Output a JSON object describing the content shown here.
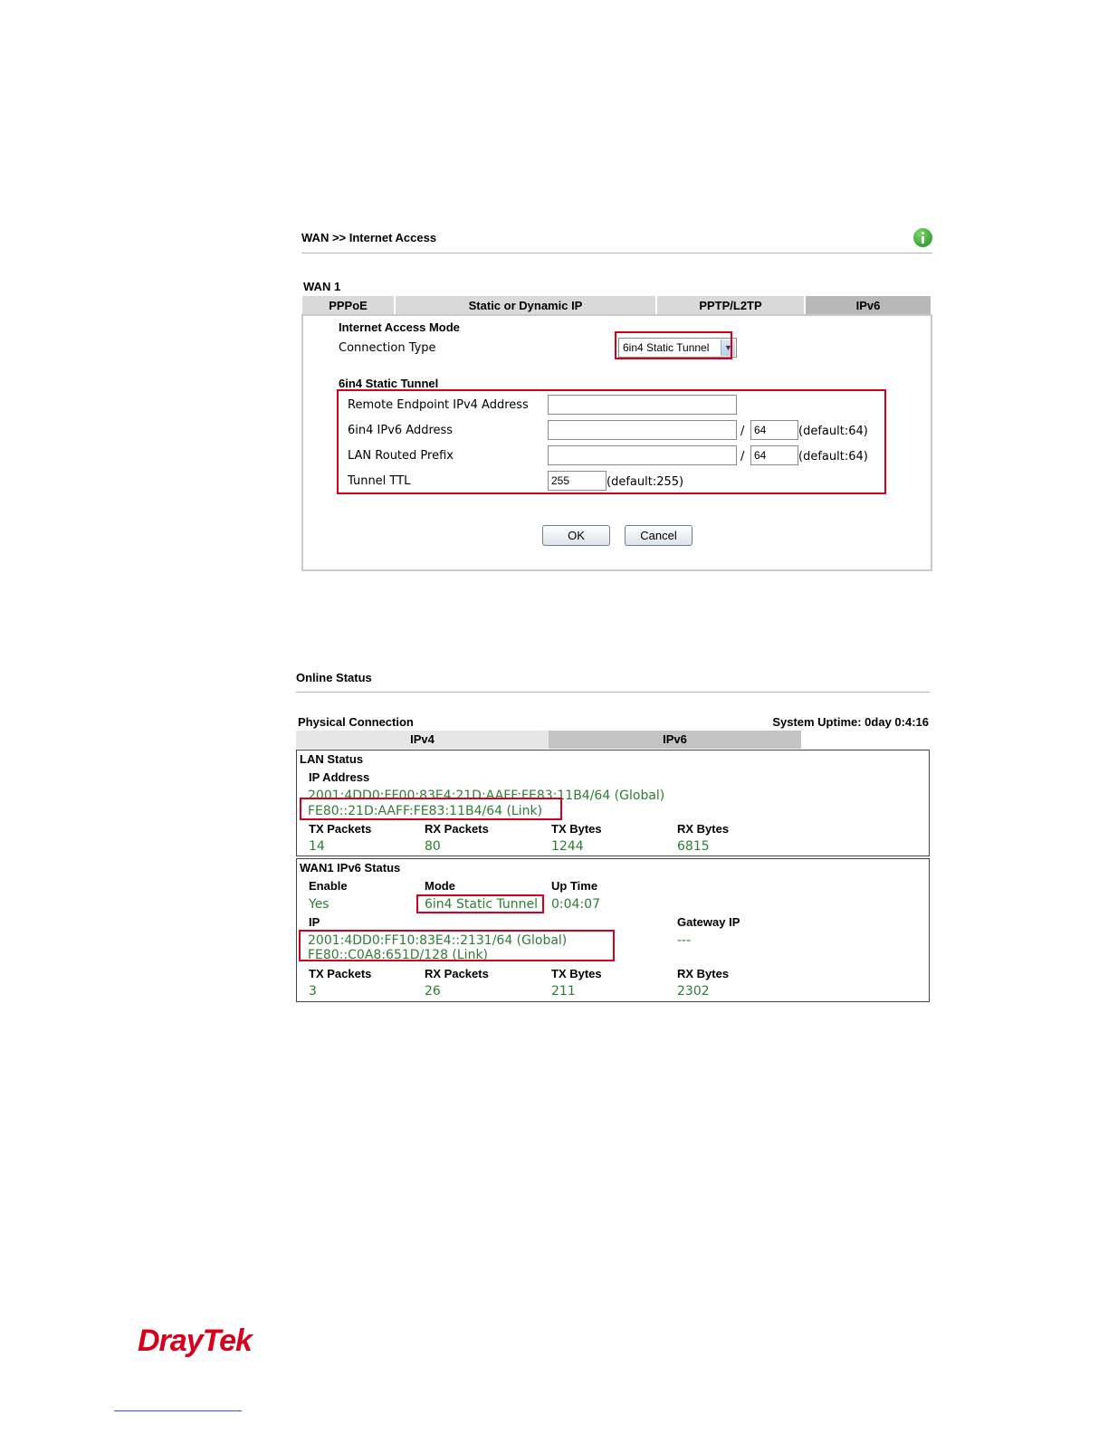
{
  "wan": {
    "breadcrumb": "WAN >> Internet Access",
    "section": "WAN 1",
    "tabs": [
      "PPPoE",
      "Static or Dynamic IP",
      "PPTP/L2TP",
      "IPv6"
    ],
    "mode_heading": "Internet Access Mode",
    "connection_type_label": "Connection Type",
    "connection_type_value": "6in4 Static Tunnel",
    "tunnel_heading": "6in4 Static Tunnel",
    "remote_endpoint_label": "Remote Endpoint IPv4 Address",
    "remote_endpoint_value": "",
    "ipv6_address_label": "6in4 IPv6 Address",
    "ipv6_address_value": "",
    "ipv6_prefix_len": "64",
    "ipv6_default": "(default:64)",
    "lan_prefix_label": "LAN Routed Prefix",
    "lan_prefix_value": "",
    "lan_prefix_len": "64",
    "lan_default": "(default:64)",
    "ttl_label": "Tunnel TTL",
    "ttl_value": "255",
    "ttl_default": "(default:255)",
    "slash": "/",
    "ok_label": "OK",
    "cancel_label": "Cancel"
  },
  "status": {
    "title": "Online Status",
    "physical": "Physical Connection",
    "uptime": "System Uptime: 0day 0:4:16",
    "tabs": [
      "IPv4",
      "IPv6"
    ],
    "lan": {
      "heading": "LAN Status",
      "ip_label": "IP Address",
      "ip_global": "2001:4DD0:FF00:83E4:21D:AAFF:FE83:11B4/64 (Global)",
      "ip_link": "FE80::21D:AAFF:FE83:11B4/64 (Link)",
      "headers": [
        "TX Packets",
        "RX Packets",
        "TX Bytes",
        "RX Bytes"
      ],
      "values": [
        "14",
        "80",
        "1244",
        "6815"
      ]
    },
    "wan": {
      "heading": "WAN1 IPv6 Status",
      "headers1": [
        "Enable",
        "Mode",
        "Up Time"
      ],
      "values1": [
        "Yes",
        "6in4 Static Tunnel",
        "0:04:07"
      ],
      "ip_label": "IP",
      "gateway_label": "Gateway IP",
      "ip_global": "2001:4DD0:FF10:83E4::2131/64 (Global)",
      "ip_link": "FE80::C0A8:651D/128 (Link)",
      "gateway_value": "---",
      "headers2": [
        "TX Packets",
        "RX Packets",
        "TX Bytes",
        "RX Bytes"
      ],
      "values2": [
        "3",
        "26",
        "211",
        "2302"
      ]
    }
  },
  "footer": {
    "logo": "DrayTek",
    "brand_color": "#d6001c"
  }
}
